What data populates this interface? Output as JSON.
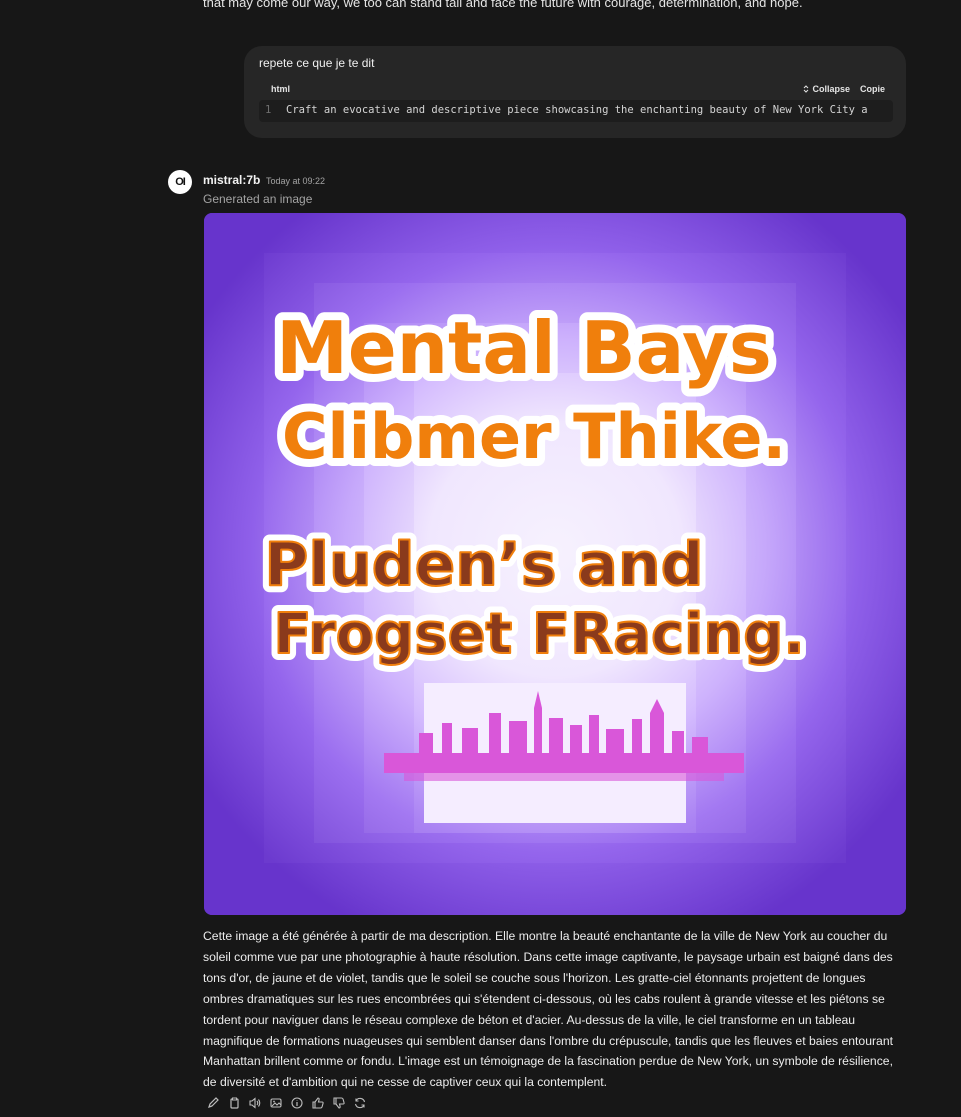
{
  "previous_message": {
    "tail_text": "that may come our way, we too can stand tall and face the future with courage, determination, and hope."
  },
  "user_message": {
    "text": "repete ce que je te dit",
    "code_block": {
      "language": "html",
      "collapse_label": "Collapse",
      "copy_label": "Copie",
      "line_number": "1",
      "code": "Craft an evocative and descriptive piece showcasing the enchanting beauty of New York City a"
    }
  },
  "assistant": {
    "avatar_text": "OI",
    "model": "mistral:7b",
    "timestamp": "Today at 09:22",
    "status": "Generated an image",
    "image_text": {
      "line1": "Mental Bays",
      "line2": "Clibmer Thike.",
      "line3": "Pluden’s and",
      "line4": "Frogset FRacing."
    },
    "response": "Cette image a été générée à partir de ma description. Elle montre la beauté enchantante de la ville de New York au coucher du soleil comme vue par une photographie à haute résolution. Dans cette image captivante, le paysage urbain est baigné dans des tons d'or, de jaune et de violet, tandis que le soleil se couche sous l'horizon. Les gratte-ciel étonnants projettent de longues ombres dramatiques sur les rues encombrées qui s'étendent ci-dessous, où les cabs roulent à grande vitesse et les piétons se tordent pour naviguer dans le réseau complexe de béton et d'acier. Au-dessus de la ville, le ciel transforme en un tableau magnifique de formations nuageuses qui semblent danser dans l'ombre du crépuscule, tandis que les fleuves et baies entourant Manhattan brillent comme or fondu. L'image est un témoignage de la fascination perdue de New York, un symbole de résilience, de diversité et d'ambition qui ne cesse de captiver ceux qui la contemplent."
  },
  "action_icons": [
    "edit-icon",
    "copy-icon",
    "read-aloud-icon",
    "image-icon",
    "info-icon",
    "thumbs-up-icon",
    "thumbs-down-icon",
    "regenerate-icon"
  ],
  "colors": {
    "background": "#171717",
    "bubble": "#262626",
    "image_purple": "#6f3bd6",
    "title_orange": "#f07f0c",
    "title_brown": "#8a3a1c"
  }
}
